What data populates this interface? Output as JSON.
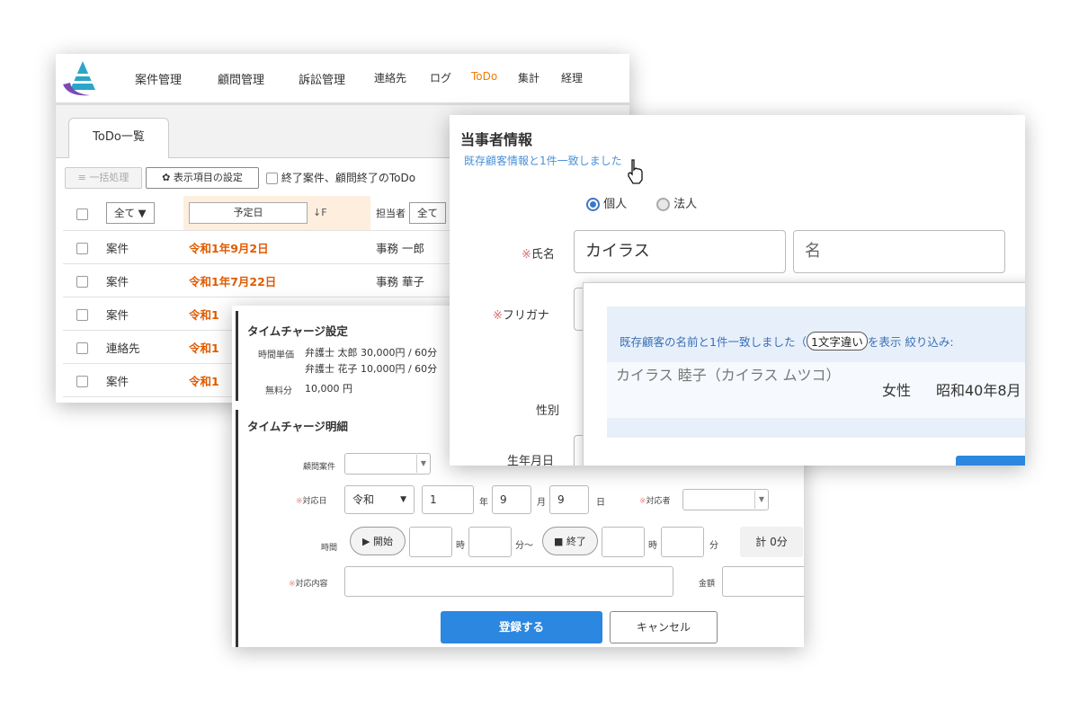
{
  "todo_panel": {
    "nav": [
      "案件管理",
      "顧問管理",
      "訴訟管理",
      "連絡先",
      "ログ",
      "ToDo",
      "集計",
      "経理"
    ],
    "nav_active": "ToDo",
    "tab_label": "ToDo一覧",
    "bulk_button": "一括処理",
    "settings_button": "表示項目の設定",
    "filter_checkbox_label": "終了案件、顧問終了のToDo",
    "table": {
      "type_filter": "全て ▼",
      "date_header": "予定日",
      "assignee_header": "担当者",
      "assignee_filter": "全て",
      "rows": [
        {
          "type": "案件",
          "date": "令和1年9月2日",
          "assignee": "事務 一郎"
        },
        {
          "type": "案件",
          "date": "令和1年7月22日",
          "assignee": "事務 華子"
        },
        {
          "type": "案件",
          "date": "令和1",
          "assignee": ""
        },
        {
          "type": "連絡先",
          "date": "令和1",
          "assignee": ""
        },
        {
          "type": "案件",
          "date": "令和1",
          "assignee": ""
        }
      ]
    },
    "accent_color": "#f07c00"
  },
  "time_charge_panel": {
    "settings_title": "タイムチャージ設定",
    "rate_label": "時間単価",
    "rate_line1": "弁護士 太郎 30,000円 / 60分",
    "rate_line2": "弁護士 花子 10,000円 / 60分",
    "free_label": "無料分",
    "free_value": "10,000 円",
    "detail_title": "タイムチャージ明細",
    "advisory_case_label": "顧問案件",
    "date_label": "対応日",
    "era_value": "令和",
    "year_value": "1",
    "year_unit": "年",
    "month_value": "9",
    "month_unit": "月",
    "day_value": "9",
    "day_unit": "日",
    "responder_label": "対応者",
    "time_label": "時間",
    "start_button": "▶ 開始",
    "hour_unit": "時",
    "minute_range_unit": "分～",
    "stop_button": "■ 終了",
    "hour_unit2": "時",
    "minute_unit": "分",
    "total": "計 0分",
    "content_label": "対応内容",
    "amount_label": "金額",
    "required_mark": "※",
    "register_button": "登録する",
    "cancel_button": "キャンセル",
    "primary_color": "#2b87e0"
  },
  "party_panel": {
    "title": "当事者情報",
    "match_link": "既存顧客情報と1件一致しました",
    "radio_individual": "個人",
    "radio_corporate": "法人",
    "required_mark": "※",
    "name_label": "氏名",
    "surname_value": "カイラス",
    "given_placeholder": "名",
    "furigana_label": "フリガナ",
    "gender_label": "性別",
    "birthdate_label": "生年月日",
    "popup": {
      "msg_prefix": "既存顧客の名前と1件一致しました（",
      "msg_badge": "1文字違い",
      "msg_suffix": "を表示 絞り込み:",
      "result_name": "カイラス 睦子（カイラス ムツコ）",
      "result_gender": "女性",
      "result_birth": "昭和40年8月"
    },
    "link_color": "#4a90d9"
  }
}
